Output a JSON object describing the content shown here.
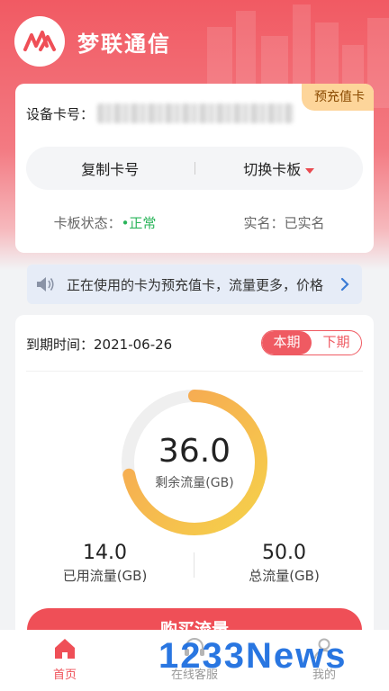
{
  "app": {
    "title": "梦联通信",
    "logo_icon": "mlink-logo-icon"
  },
  "card_info": {
    "badge": "预充值卡",
    "device_label": "设备卡号：",
    "copy_label": "复制卡号",
    "switch_label": "切换卡板",
    "status_label": "卡板状态：",
    "status_value": "•正常",
    "realname_label": "实名：",
    "realname_value": "已实名",
    "colors": {
      "ok": "#2bb55b",
      "accent": "#e94a50"
    }
  },
  "notice": {
    "text": "正在使用的卡为预充值卡，流量更多，价格",
    "icon": "speaker-icon"
  },
  "usage": {
    "expire_label": "到期时间：",
    "expire_date": "2021-06-26",
    "tabs": [
      "本期",
      "下期"
    ],
    "active_tab": "本期",
    "remaining_value": "36.0",
    "remaining_label": "剩余流量(GB)",
    "remaining_fraction": 0.72,
    "used_value": "14.0",
    "used_label": "已用流量(GB)",
    "total_value": "50.0",
    "total_label": "总流量(GB)",
    "buy_label": "购买流量"
  },
  "tabbar": {
    "items": [
      {
        "label": "首页",
        "icon": "home-icon",
        "active": true
      },
      {
        "label": "在线客服",
        "icon": "customer-service-icon",
        "active": false
      },
      {
        "label": "我的",
        "icon": "user-icon",
        "active": false
      }
    ]
  },
  "watermark": "1233News",
  "colors": {
    "brand": "#ef4f57",
    "gauge_start": "#f5d14a",
    "gauge_end": "#f7a254",
    "gauge_track": "#efefef"
  }
}
